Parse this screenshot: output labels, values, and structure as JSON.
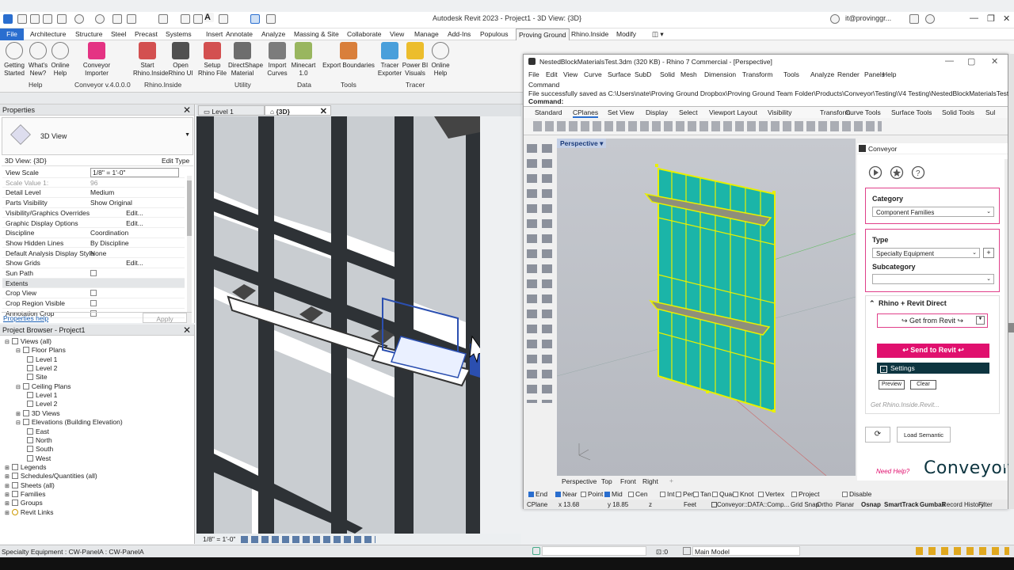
{
  "window": {
    "title": "Autodesk Revit 2023 - Project1 - 3D View: {3D}",
    "signin": "it@provinggr..."
  },
  "ribbon": {
    "tabs": [
      "File",
      "Architecture",
      "Structure",
      "Steel",
      "Precast",
      "Systems",
      "Insert",
      "Annotate",
      "Analyze",
      "Massing & Site",
      "Collaborate",
      "View",
      "Manage",
      "Add-Ins",
      "Populous",
      "Proving Ground",
      "Rhino.Inside",
      "Modify"
    ],
    "active_tab": "Proving Ground",
    "buttons": [
      {
        "label": "Getting Started",
        "icon": "play-icon"
      },
      {
        "label": "What's New?",
        "icon": "star-icon"
      },
      {
        "label": "Online Help",
        "icon": "help-icon"
      },
      {
        "label": "Conveyor Importer",
        "icon": "conveyor-icon"
      },
      {
        "label": "Start Rhino.Inside",
        "icon": "rhino-icon"
      },
      {
        "label": "Open Rhino UI",
        "icon": "rhino-ui-icon"
      },
      {
        "label": "Setup Rhino File",
        "icon": "setup-file-icon"
      },
      {
        "label": "DirectShape Material",
        "icon": "directshape-icon"
      },
      {
        "label": "Import Curves",
        "icon": "curves-icon"
      },
      {
        "label": "Minecart 1.0",
        "icon": "minecart-icon"
      },
      {
        "label": "Export Boundaries",
        "icon": "boundaries-icon"
      },
      {
        "label": "Tracer Exporter",
        "icon": "tracer-icon"
      },
      {
        "label": "Power BI Visuals",
        "icon": "powerbi-icon"
      },
      {
        "label": "Online Help",
        "icon": "help-icon"
      }
    ],
    "panels": [
      "Help",
      "Conveyor v.4.0.0.0",
      "Rhino.Inside",
      "Utility",
      "Data",
      "Tools",
      "Tracer"
    ]
  },
  "properties": {
    "title": "Properties",
    "type_name": "3D View",
    "selector": "3D View: {3D}",
    "edit_type": "Edit Type",
    "rows": [
      {
        "k": "View Scale",
        "v": "1/8\" = 1'-0\"",
        "kind": "input"
      },
      {
        "k": "Scale Value    1:",
        "v": "96",
        "kind": "gray"
      },
      {
        "k": "Detail Level",
        "v": "Medium"
      },
      {
        "k": "Parts Visibility",
        "v": "Show Original"
      },
      {
        "k": "Visibility/Graphics Overrides",
        "v": "Edit...",
        "kind": "btn"
      },
      {
        "k": "Graphic Display Options",
        "v": "Edit...",
        "kind": "btn"
      },
      {
        "k": "Discipline",
        "v": "Coordination"
      },
      {
        "k": "Show Hidden Lines",
        "v": "By Discipline"
      },
      {
        "k": "Default Analysis Display Style",
        "v": "None"
      },
      {
        "k": "Show Grids",
        "v": "Edit...",
        "kind": "btn"
      },
      {
        "k": "Sun Path",
        "v": "",
        "kind": "check"
      },
      {
        "k": "Extents",
        "v": "",
        "kind": "section"
      },
      {
        "k": "Crop View",
        "v": "",
        "kind": "check"
      },
      {
        "k": "Crop Region Visible",
        "v": "",
        "kind": "check"
      },
      {
        "k": "Annotation Crop",
        "v": "",
        "kind": "check"
      }
    ],
    "help": "Properties help",
    "apply": "Apply"
  },
  "browser": {
    "title": "Project Browser - Project1",
    "items": [
      {
        "t": "Views (all)",
        "d": 0
      },
      {
        "t": "Floor Plans",
        "d": 1
      },
      {
        "t": "Level 1",
        "d": 2
      },
      {
        "t": "Level 2",
        "d": 2
      },
      {
        "t": "Site",
        "d": 2
      },
      {
        "t": "Ceiling Plans",
        "d": 1
      },
      {
        "t": "Level 1",
        "d": 2
      },
      {
        "t": "Level 2",
        "d": 2
      },
      {
        "t": "3D Views",
        "d": 1
      },
      {
        "t": "Elevations (Building Elevation)",
        "d": 1
      },
      {
        "t": "East",
        "d": 2
      },
      {
        "t": "North",
        "d": 2
      },
      {
        "t": "South",
        "d": 2
      },
      {
        "t": "West",
        "d": 2
      },
      {
        "t": "Legends",
        "d": 0
      },
      {
        "t": "Schedules/Quantities (all)",
        "d": 0
      },
      {
        "t": "Sheets (all)",
        "d": 0
      },
      {
        "t": "Families",
        "d": 0
      },
      {
        "t": "Groups",
        "d": 0
      },
      {
        "t": "Revit Links",
        "d": 0
      }
    ]
  },
  "view_tabs": [
    "Level 1",
    "{3D}"
  ],
  "view_scale": "1/8\" = 1'-0\"",
  "status": {
    "left": "Specialty Equipment : CW-PanelA : CW-PanelA",
    "coord": ":0",
    "model": "Main Model"
  },
  "rhino": {
    "title": "NestedBlockMaterialsTest.3dm (320 KB) - Rhino 7 Commercial - [Perspective]",
    "menu": [
      "File",
      "Edit",
      "View",
      "Curve",
      "Surface",
      "SubD",
      "Solid",
      "Mesh",
      "Dimension",
      "Transform",
      "Tools",
      "Analyze",
      "Render",
      "Panels",
      "Help"
    ],
    "cmd_lines": [
      "Command",
      "File successfully saved as C:\\Users\\nate\\Proving Ground Dropbox\\Proving Ground Team Folder\\Products\\Conveyor\\Testing\\V4 Testing\\NestedBlockMaterialsTest.3dm."
    ],
    "cmd_prompt": "Command:",
    "tabs": [
      "Standard",
      "CPlanes",
      "Set View",
      "Display",
      "Select",
      "Viewport Layout",
      "Visibility",
      "Transform",
      "Curve Tools",
      "Surface Tools",
      "Solid Tools",
      "Sul"
    ],
    "viewport_label": "Perspective",
    "vp_tabs": [
      "Perspective",
      "Top",
      "Front",
      "Right"
    ],
    "osnaps": [
      {
        "l": "End",
        "on": true
      },
      {
        "l": "Near",
        "on": true
      },
      {
        "l": "Point",
        "on": false
      },
      {
        "l": "Mid",
        "on": true
      },
      {
        "l": "Cen",
        "on": false
      },
      {
        "l": "Int",
        "on": false
      },
      {
        "l": "Perp",
        "on": false
      },
      {
        "l": "Tan",
        "on": false
      },
      {
        "l": "Quad",
        "on": false
      },
      {
        "l": "Knot",
        "on": false
      },
      {
        "l": "Vertex",
        "on": false
      },
      {
        "l": "Project",
        "on": false
      },
      {
        "l": "Disable",
        "on": false
      }
    ],
    "status": {
      "cplane": "CPlane",
      "x": "x 13.68",
      "y": "y 18.85",
      "z": "z",
      "units": "Feet",
      "layer": "Conveyor::DATA::Comp...",
      "items": [
        "Grid Snap",
        "Ortho",
        "Planar"
      ],
      "bold_items": [
        "Osnap",
        "SmartTrack",
        "Gumball"
      ],
      "tail": [
        "Record History",
        "Filter"
      ]
    }
  },
  "conveyor": {
    "title": "Conveyor",
    "category_label": "Category",
    "category_value": "Component Families",
    "type_label": "Type",
    "type_value": "Specialty Equipment",
    "subcategory_label": "Subcategory",
    "subcategory_value": "",
    "section": "Rhino + Revit Direct",
    "get_btn": "↪ Get from Revit ↪",
    "send_btn": "↩ Send to Revit ↩",
    "settings": "Settings",
    "preview": "Preview",
    "clear": "Clear",
    "get_rhino": "Get Rhino.Inside.Revit...",
    "load_semantic": "Load Semantic",
    "need_help": "Need Help?",
    "logo": "Conveyor",
    "colors": {
      "accent": "#e0106e",
      "dark": "#0d3540"
    }
  }
}
